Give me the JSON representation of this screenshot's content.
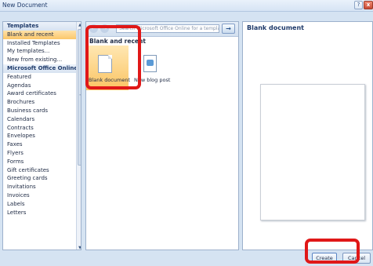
{
  "window": {
    "title": "New Document",
    "help_label": "?",
    "close_label": "x"
  },
  "categories": [
    {
      "label": "Templates",
      "header": true
    },
    {
      "label": "Blank and recent",
      "selected": true
    },
    {
      "label": "Installed Templates"
    },
    {
      "label": "My templates..."
    },
    {
      "label": "New from existing..."
    },
    {
      "label": "Microsoft Office Online",
      "header": true
    },
    {
      "label": "Featured"
    },
    {
      "label": "Agendas"
    },
    {
      "label": "Award certificates"
    },
    {
      "label": "Brochures"
    },
    {
      "label": "Business cards"
    },
    {
      "label": "Calendars"
    },
    {
      "label": "Contracts"
    },
    {
      "label": "Envelopes"
    },
    {
      "label": "Faxes"
    },
    {
      "label": "Flyers"
    },
    {
      "label": "Forms"
    },
    {
      "label": "Gift certificates"
    },
    {
      "label": "Greeting cards"
    },
    {
      "label": "Invitations"
    },
    {
      "label": "Invoices"
    },
    {
      "label": "Labels"
    },
    {
      "label": "Letters"
    }
  ],
  "scrollbar": {
    "up": "▲",
    "down": "▼",
    "grip": "≡"
  },
  "toolbar": {
    "back_label": "←",
    "forward_label": "→",
    "search_placeholder": "Search Microsoft Office Online for a template",
    "search_go_label": "→"
  },
  "main": {
    "group_header": "Blank and recent",
    "templates": [
      {
        "label": "Blank document",
        "selected": true
      },
      {
        "label": "New blog post"
      }
    ]
  },
  "preview": {
    "title": "Blank document"
  },
  "footer": {
    "create_label": "Create",
    "cancel_label": "Cancel"
  },
  "colors": {
    "selection": "#fbc76a",
    "highlight": "#e01818",
    "dialog_bg": "#d5e3f2"
  }
}
